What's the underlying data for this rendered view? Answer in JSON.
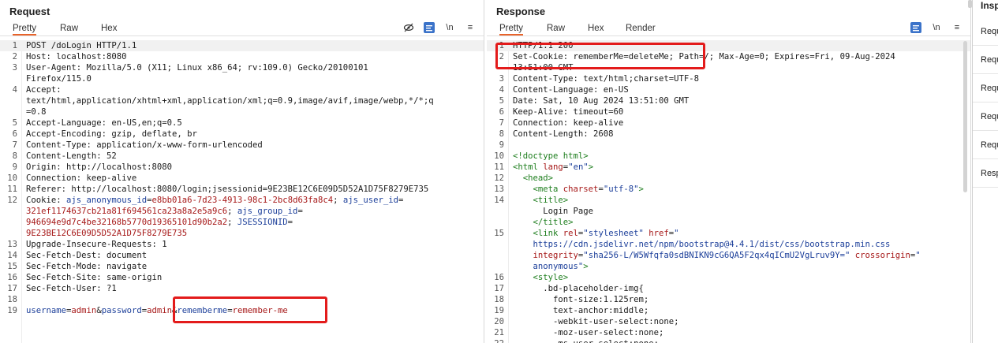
{
  "request": {
    "title": "Request",
    "tabs": [
      "Pretty",
      "Raw",
      "Hex"
    ],
    "active_tab": "Pretty",
    "lines": [
      {
        "n": "1",
        "segs": [
          [
            "k",
            "POST /doLogin HTTP/1.1"
          ]
        ]
      },
      {
        "n": "2",
        "segs": [
          [
            "k",
            "Host: localhost:8080"
          ]
        ]
      },
      {
        "n": "3",
        "segs": [
          [
            "k",
            "User-Agent: Mozilla/5.0 (X11; Linux x86_64; rv:109.0) Gecko/20100101"
          ]
        ]
      },
      {
        "n": "",
        "segs": [
          [
            "k",
            "Firefox/115.0"
          ]
        ]
      },
      {
        "n": "4",
        "segs": [
          [
            "k",
            "Accept:"
          ]
        ]
      },
      {
        "n": "",
        "segs": [
          [
            "k",
            "text/html,application/xhtml+xml,application/xml;q=0.9,image/avif,image/webp,*/*;q"
          ]
        ]
      },
      {
        "n": "",
        "segs": [
          [
            "k",
            "=0.8"
          ]
        ]
      },
      {
        "n": "5",
        "segs": [
          [
            "k",
            "Accept-Language: en-US,en;q=0.5"
          ]
        ]
      },
      {
        "n": "6",
        "segs": [
          [
            "k",
            "Accept-Encoding: gzip, deflate, br"
          ]
        ]
      },
      {
        "n": "7",
        "segs": [
          [
            "k",
            "Content-Type: application/x-www-form-urlencoded"
          ]
        ]
      },
      {
        "n": "8",
        "segs": [
          [
            "k",
            "Content-Length: 52"
          ]
        ]
      },
      {
        "n": "9",
        "segs": [
          [
            "k",
            "Origin: http://localhost:8080"
          ]
        ]
      },
      {
        "n": "10",
        "segs": [
          [
            "k",
            "Connection: keep-alive"
          ]
        ]
      },
      {
        "n": "11",
        "segs": [
          [
            "k",
            "Referer: http://localhost:8080/login;jsessionid=9E23BE12C6E09D5D52A1D75F8279E735"
          ]
        ]
      },
      {
        "n": "12",
        "segs": [
          [
            "k",
            "Cookie: "
          ],
          [
            "param",
            "ajs_anonymous_id"
          ],
          [
            "k",
            "="
          ],
          [
            "val",
            "e8bb01a6-7d23-4913-98c1-2bc8d63fa8c4"
          ],
          [
            "k",
            "; "
          ],
          [
            "param",
            "ajs_user_id"
          ],
          [
            "k",
            "="
          ]
        ]
      },
      {
        "n": "",
        "segs": [
          [
            "val",
            "321ef1174637cb21a81f694561ca23a8a2e5a9c6"
          ],
          [
            "k",
            "; "
          ],
          [
            "param",
            "ajs_group_id"
          ],
          [
            "k",
            "="
          ]
        ]
      },
      {
        "n": "",
        "segs": [
          [
            "val",
            "946694e9d7c4be32168b5770d19365101d90b2a2"
          ],
          [
            "k",
            "; "
          ],
          [
            "param",
            "JSESSIONID"
          ],
          [
            "k",
            "="
          ]
        ]
      },
      {
        "n": "",
        "segs": [
          [
            "val",
            "9E23BE12C6E09D5D52A1D75F8279E735"
          ]
        ]
      },
      {
        "n": "13",
        "segs": [
          [
            "k",
            "Upgrade-Insecure-Requests: 1"
          ]
        ]
      },
      {
        "n": "14",
        "segs": [
          [
            "k",
            "Sec-Fetch-Dest: document"
          ]
        ]
      },
      {
        "n": "15",
        "segs": [
          [
            "k",
            "Sec-Fetch-Mode: navigate"
          ]
        ]
      },
      {
        "n": "16",
        "segs": [
          [
            "k",
            "Sec-Fetch-Site: same-origin"
          ]
        ]
      },
      {
        "n": "17",
        "segs": [
          [
            "k",
            "Sec-Fetch-User: ?1"
          ]
        ]
      },
      {
        "n": "18",
        "segs": []
      },
      {
        "n": "19",
        "segs": [
          [
            "param",
            "username"
          ],
          [
            "k",
            "="
          ],
          [
            "val",
            "admin"
          ],
          [
            "k",
            "&"
          ],
          [
            "param",
            "password"
          ],
          [
            "k",
            "="
          ],
          [
            "val",
            "admin"
          ],
          [
            "k",
            "&"
          ],
          [
            "param",
            "rememberme"
          ],
          [
            "k",
            "="
          ],
          [
            "val",
            "remember-me"
          ]
        ]
      }
    ]
  },
  "response": {
    "title": "Response",
    "tabs": [
      "Pretty",
      "Raw",
      "Hex",
      "Render"
    ],
    "active_tab": "Pretty",
    "lines": [
      {
        "n": "1",
        "segs": [
          [
            "k",
            "HTTP/1.1 200 "
          ]
        ]
      },
      {
        "n": "2",
        "segs": [
          [
            "k",
            "Set-Cookie: rememberMe=deleteMe; Path=/; Max-Age=0; Expires=Fri, 09-Aug-2024"
          ]
        ]
      },
      {
        "n": "",
        "segs": [
          [
            "k",
            "13:51:00 GMT"
          ]
        ]
      },
      {
        "n": "3",
        "segs": [
          [
            "k",
            "Content-Type: text/html;charset=UTF-8"
          ]
        ]
      },
      {
        "n": "4",
        "segs": [
          [
            "k",
            "Content-Language: en-US"
          ]
        ]
      },
      {
        "n": "5",
        "segs": [
          [
            "k",
            "Date: Sat, 10 Aug 2024 13:51:00 GMT"
          ]
        ]
      },
      {
        "n": "6",
        "segs": [
          [
            "k",
            "Keep-Alive: timeout=60"
          ]
        ]
      },
      {
        "n": "7",
        "segs": [
          [
            "k",
            "Connection: keep-alive"
          ]
        ]
      },
      {
        "n": "8",
        "segs": [
          [
            "k",
            "Content-Length: 2608"
          ]
        ]
      },
      {
        "n": "9",
        "segs": []
      },
      {
        "n": "10",
        "segs": [
          [
            "tag",
            "<!doctype html>"
          ]
        ]
      },
      {
        "n": "11",
        "segs": [
          [
            "tag",
            "<html "
          ],
          [
            "attr",
            "lang"
          ],
          [
            "k",
            "="
          ],
          [
            "str",
            "\"en\""
          ],
          [
            "tag",
            ">"
          ]
        ]
      },
      {
        "n": "12",
        "segs": [
          [
            "tag",
            "  <head>"
          ]
        ]
      },
      {
        "n": "13",
        "segs": [
          [
            "tag",
            "    <meta "
          ],
          [
            "attr",
            "charset"
          ],
          [
            "k",
            "="
          ],
          [
            "str",
            "\"utf-8\""
          ],
          [
            "tag",
            ">"
          ]
        ]
      },
      {
        "n": "14",
        "segs": [
          [
            "tag",
            "    <title>"
          ]
        ]
      },
      {
        "n": "",
        "segs": [
          [
            "k",
            "      Login Page"
          ]
        ]
      },
      {
        "n": "",
        "segs": [
          [
            "tag",
            "    </title>"
          ]
        ]
      },
      {
        "n": "15",
        "segs": [
          [
            "tag",
            "    <link "
          ],
          [
            "attr",
            "rel"
          ],
          [
            "k",
            "="
          ],
          [
            "str",
            "\"stylesheet\""
          ],
          [
            "k",
            " "
          ],
          [
            "attr",
            "href"
          ],
          [
            "k",
            "="
          ],
          [
            "str",
            "\""
          ]
        ]
      },
      {
        "n": "",
        "segs": [
          [
            "str",
            "    https://cdn.jsdelivr.net/npm/bootstrap@4.4.1/dist/css/bootstrap.min.css"
          ]
        ]
      },
      {
        "n": "",
        "segs": [
          [
            "attr",
            "    integrity"
          ],
          [
            "k",
            "="
          ],
          [
            "str",
            "\"sha256-L/W5Wfqfa0sdBNIKN9cG6QA5F2qx4qICmU2VgLruv9Y=\""
          ],
          [
            "k",
            " "
          ],
          [
            "attr",
            "crossorigin"
          ],
          [
            "k",
            "="
          ],
          [
            "str",
            "\""
          ]
        ]
      },
      {
        "n": "",
        "segs": [
          [
            "str",
            "    anonymous\""
          ],
          [
            "tag",
            ">"
          ]
        ]
      },
      {
        "n": "16",
        "segs": [
          [
            "tag",
            "    <style>"
          ]
        ]
      },
      {
        "n": "17",
        "segs": [
          [
            "k",
            "      .bd-placeholder-img{"
          ]
        ]
      },
      {
        "n": "18",
        "segs": [
          [
            "k",
            "        font-size:1.125rem;"
          ]
        ]
      },
      {
        "n": "19",
        "segs": [
          [
            "k",
            "        text-anchor:middle;"
          ]
        ]
      },
      {
        "n": "20",
        "segs": [
          [
            "k",
            "        -webkit-user-select:none;"
          ]
        ]
      },
      {
        "n": "21",
        "segs": [
          [
            "k",
            "        -moz-user-select:none;"
          ]
        ]
      },
      {
        "n": "22",
        "segs": [
          [
            "k",
            "        -ms-user-select:none;"
          ]
        ]
      }
    ]
  },
  "inspector": {
    "title": "Insp",
    "items": [
      "Requ",
      "Requ",
      "Requ",
      "Requ",
      "Requ",
      "Resp"
    ]
  }
}
